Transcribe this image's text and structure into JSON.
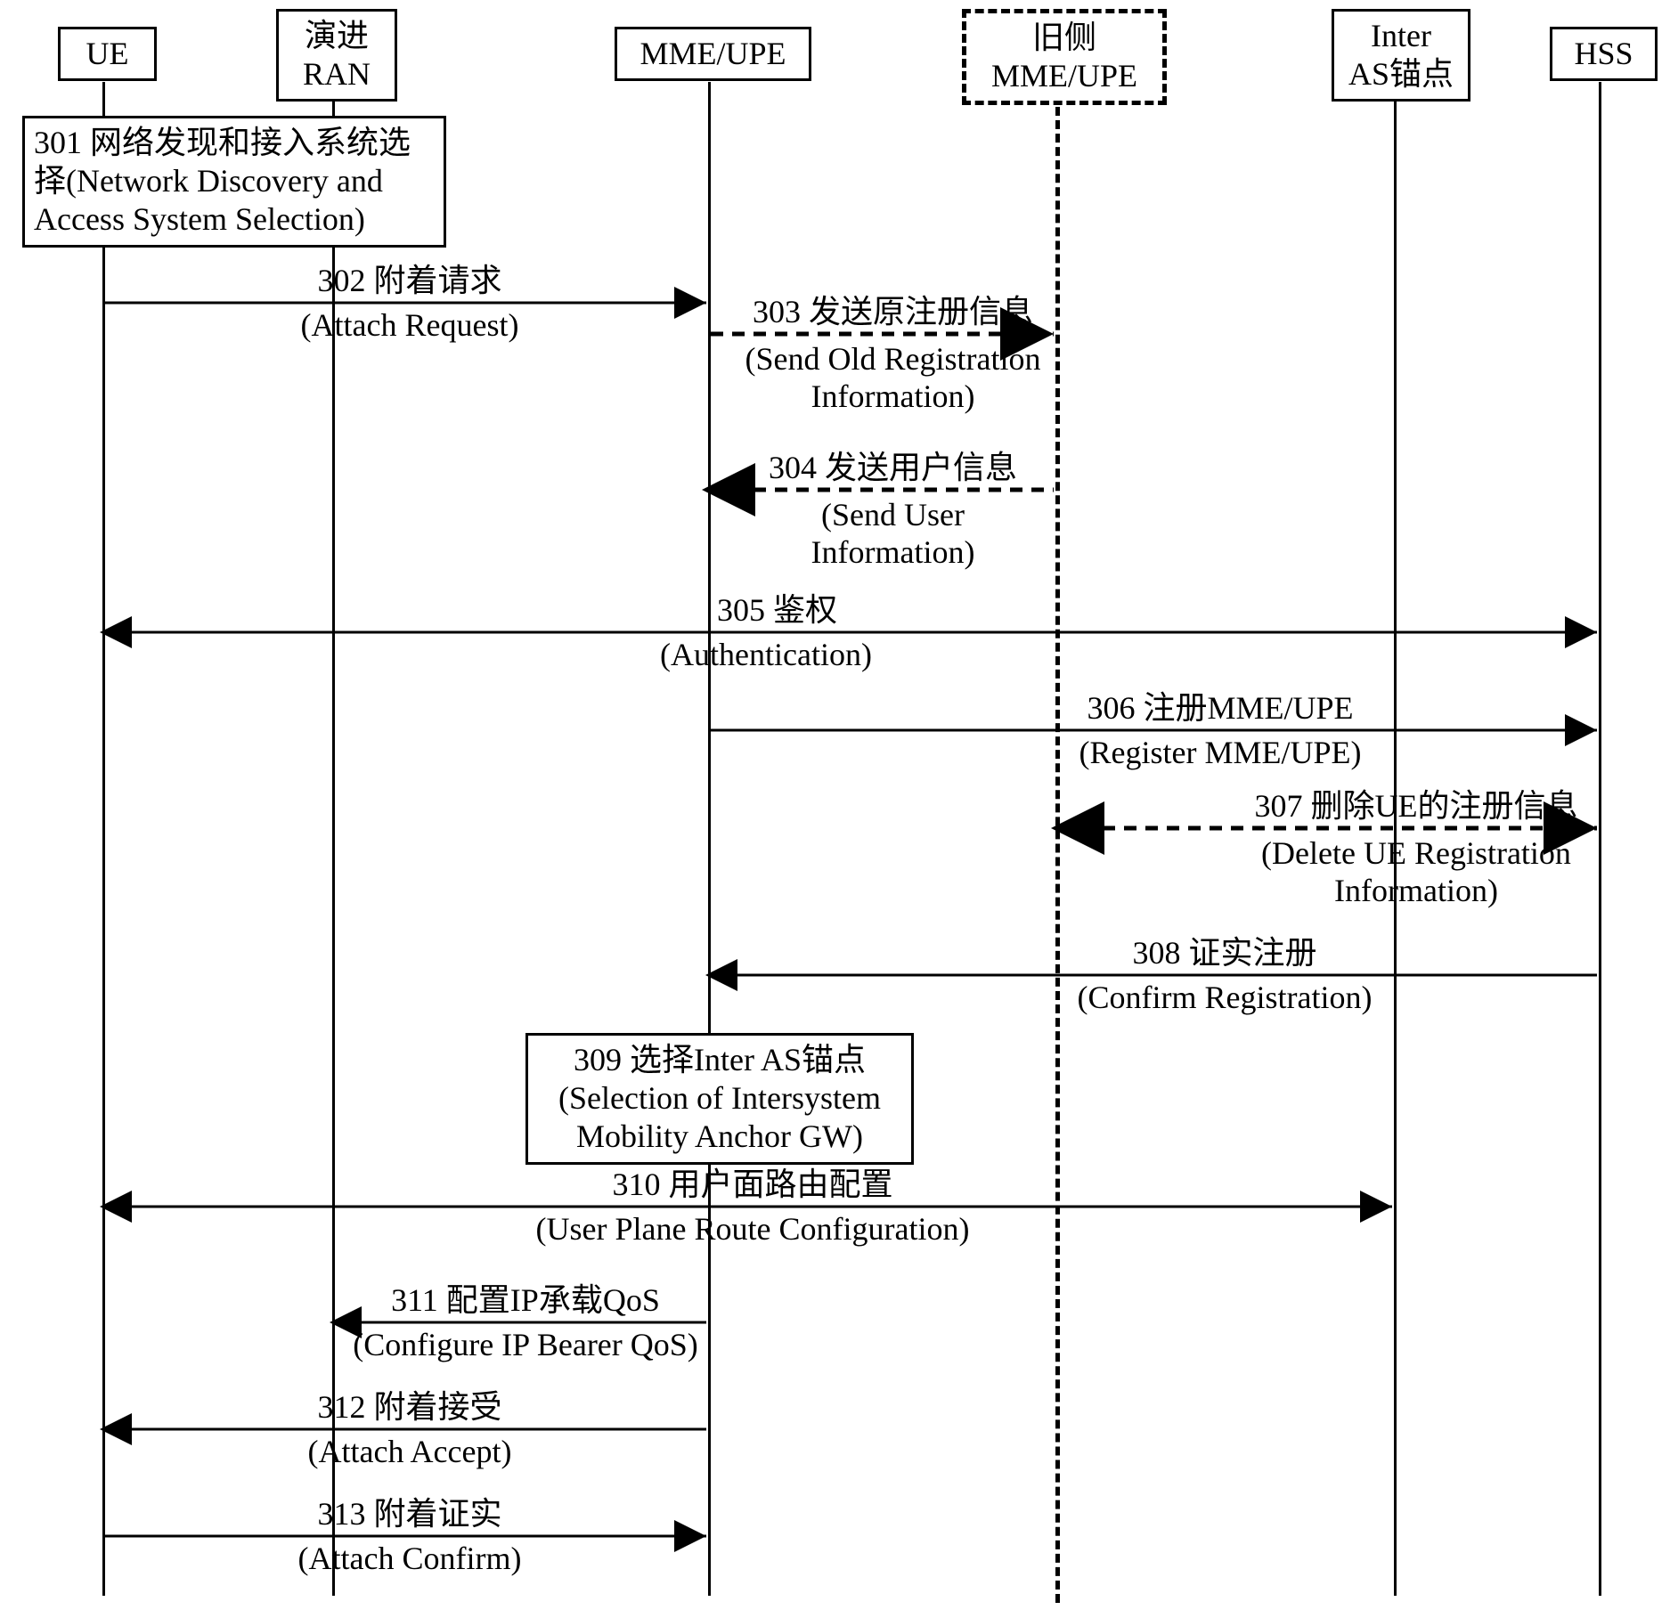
{
  "participants": {
    "ue": "UE",
    "ran_l1": "演进",
    "ran_l2": "RAN",
    "mme": "MME/UPE",
    "old_mme_l1": "旧侧",
    "old_mme_l2": "MME/UPE",
    "ias_l1": "Inter",
    "ias_l2": "AS锚点",
    "hss": "HSS"
  },
  "steps": {
    "s301_l1": "301 网络发现和接入系统选",
    "s301_l2": "择(Network Discovery and",
    "s301_l3": "Access System Selection)",
    "s302_l1": "302 附着请求",
    "s302_l2": "(Attach Request)",
    "s303_l1": "303 发送原注册信息",
    "s303_l2": "(Send Old Registration",
    "s303_l3": "Information)",
    "s304_l1": "304 发送用户信息",
    "s304_l2": "(Send User",
    "s304_l3": "Information)",
    "s305_l1": "305 鉴权",
    "s305_l2": "(Authentication)",
    "s306_l1": "306 注册MME/UPE",
    "s306_l2": "(Register MME/UPE)",
    "s307_l1": "307 删除UE的注册信息",
    "s307_l2": "(Delete UE Registration",
    "s307_l3": "Information)",
    "s308_l1": "308 证实注册",
    "s308_l2": "(Confirm Registration)",
    "s309_l1": "309 选择Inter AS锚点",
    "s309_l2": "(Selection of Intersystem",
    "s309_l3": "Mobility Anchor GW)",
    "s310_l1": "310 用户面路由配置",
    "s310_l2": "(User Plane Route Configuration)",
    "s311_l1": "311 配置IP承载QoS",
    "s311_l2": "(Configure IP Bearer QoS)",
    "s312_l1": "312 附着接受",
    "s312_l2": "(Attach Accept)",
    "s313_l1": "313 附着证实",
    "s313_l2": "(Attach Confirm)"
  }
}
